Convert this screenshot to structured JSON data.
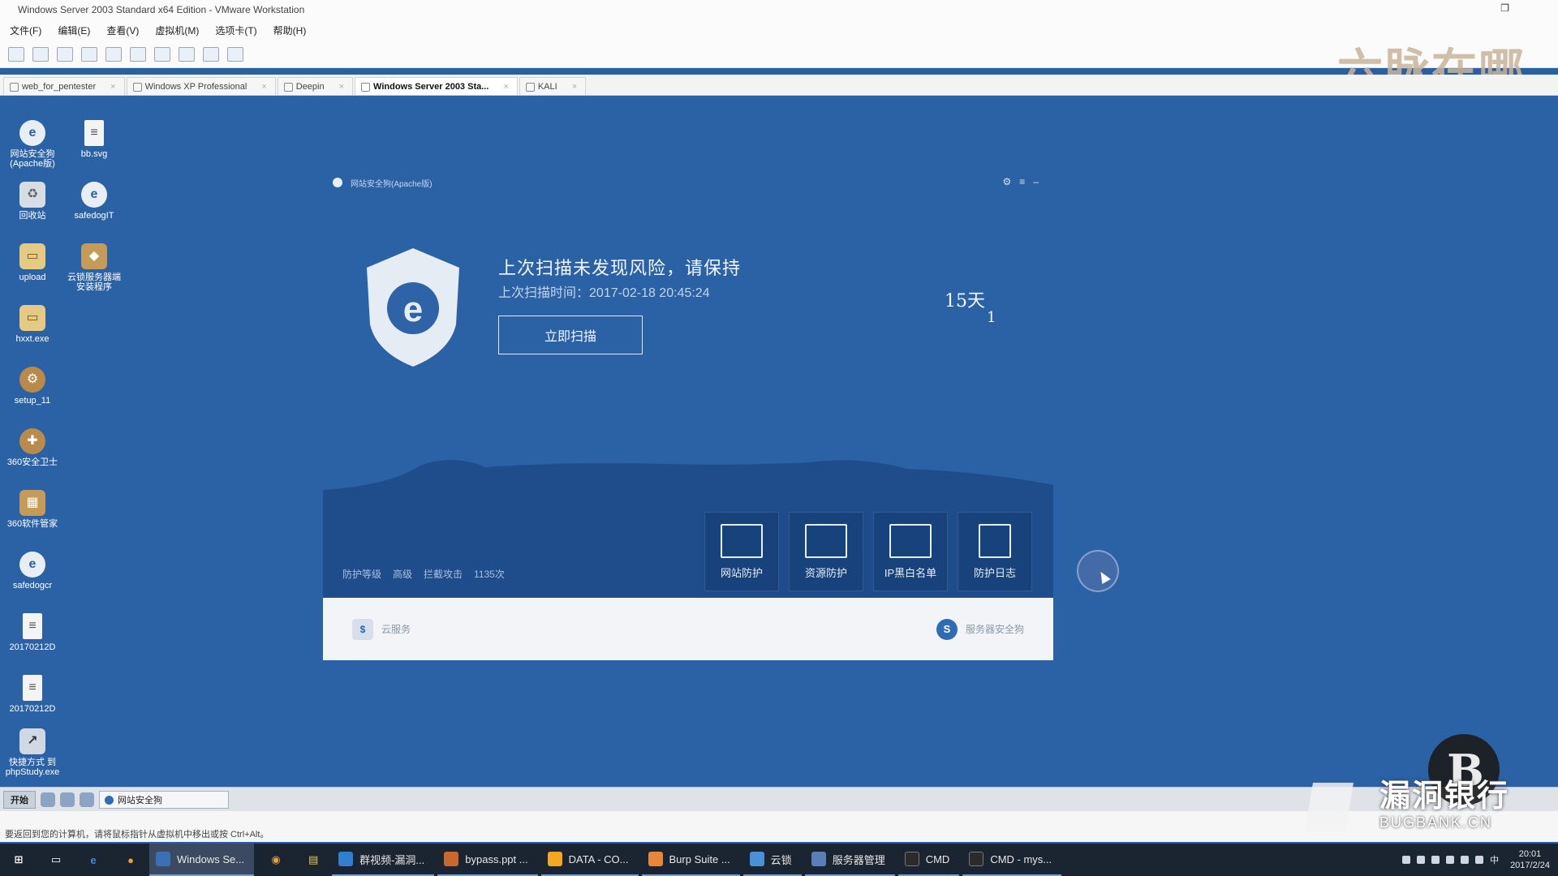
{
  "vmware": {
    "window_title": "Windows Server 2003 Standard x64 Edition - VMware Workstation",
    "menu": [
      "文件(F)",
      "编辑(E)",
      "查看(V)",
      "虚拟机(M)",
      "选项卡(T)",
      "帮助(H)"
    ],
    "tabs": [
      {
        "label": "web_for_pentester",
        "active": false
      },
      {
        "label": "Windows XP Professional",
        "active": false
      },
      {
        "label": "Deepin",
        "active": false
      },
      {
        "label": "Windows Server 2003 Sta...",
        "active": true
      },
      {
        "label": "KALI",
        "active": false
      }
    ],
    "status_text": "要返回到您的计算机，请将鼠标指针从虚拟机中移出或按 Ctrl+Alt。"
  },
  "watermark_top": "六脉在哪",
  "desktop_icons": [
    {
      "label": "网站安全狗(Apache版)",
      "icon": "shield-icon"
    },
    {
      "label": "bb.svg",
      "icon": "file-icon"
    },
    {
      "label": "回收站",
      "icon": "recycle-bin-icon"
    },
    {
      "label": "safedogIT",
      "icon": "shield-icon"
    },
    {
      "label": "upload",
      "icon": "folder-icon"
    },
    {
      "label": "云锁服务器端安装程序",
      "icon": "box-icon"
    },
    {
      "label": "hxxt.exe",
      "icon": "folder-icon"
    },
    {
      "label": "setup_11",
      "icon": "gear-icon"
    },
    {
      "label": "360安全卫士",
      "icon": "gear-icon"
    },
    {
      "label": "360软件管家",
      "icon": "box-icon"
    },
    {
      "label": "safedogcr",
      "icon": "shield-icon"
    },
    {
      "label": "20170212D",
      "icon": "file-icon"
    },
    {
      "label": "20170212D",
      "icon": "file-icon"
    },
    {
      "label": "快捷方式 到 phpStudy.exe",
      "icon": "shortcut-icon"
    }
  ],
  "app": {
    "header_text": "网站安全狗(Apache版)",
    "status_title": "上次扫描未发现风险，请保持",
    "last_scan_label": "上次扫描时间：",
    "last_scan_time": "2017-02-18 20:45:24",
    "scan_button": "立即扫描",
    "days_value": "15天",
    "days_count": "1",
    "stats": [
      "防护等级",
      "高级",
      "拦截攻击",
      "1135次"
    ],
    "features": [
      "网站防护",
      "资源防护",
      "IP黑白名单",
      "防护日志"
    ],
    "footer_left": "云服务",
    "footer_right": "服务器安全狗"
  },
  "guest_taskbar": {
    "start_label": "开始",
    "task_label": "网站安全狗"
  },
  "host_taskbar": {
    "apps": [
      {
        "label": "Windows Se...",
        "active": true,
        "color": "#3b6fb6"
      },
      {
        "label": "",
        "active": false,
        "color": "#e6a23c"
      },
      {
        "label": "",
        "active": false,
        "color": "#f0c05a"
      },
      {
        "label": "群视频-漏洞...",
        "active": false,
        "color": "#2f80d0"
      },
      {
        "label": "bypass.ppt ...",
        "active": false,
        "color": "#c8682c"
      },
      {
        "label": "DATA - CO...",
        "active": false,
        "color": "#f5a623"
      },
      {
        "label": "Burp Suite ...",
        "active": false,
        "color": "#e8863a"
      },
      {
        "label": "云锁",
        "active": false,
        "color": "#4a90d9"
      },
      {
        "label": "服务器管理",
        "active": false,
        "color": "#5a7fb8"
      },
      {
        "label": "CMD",
        "active": false,
        "color": "#2b2b2b"
      },
      {
        "label": "CMD - mys...",
        "active": false,
        "color": "#2b2b2b"
      }
    ],
    "clock_time": "20:01",
    "clock_date": "2017/2/24",
    "ime": "中"
  },
  "brand": {
    "name": "漏洞银行",
    "domain": "BUGBANK.CN"
  },
  "colors": {
    "desktop_bg": "#2b62a6",
    "accent": "#2f6cb3"
  }
}
